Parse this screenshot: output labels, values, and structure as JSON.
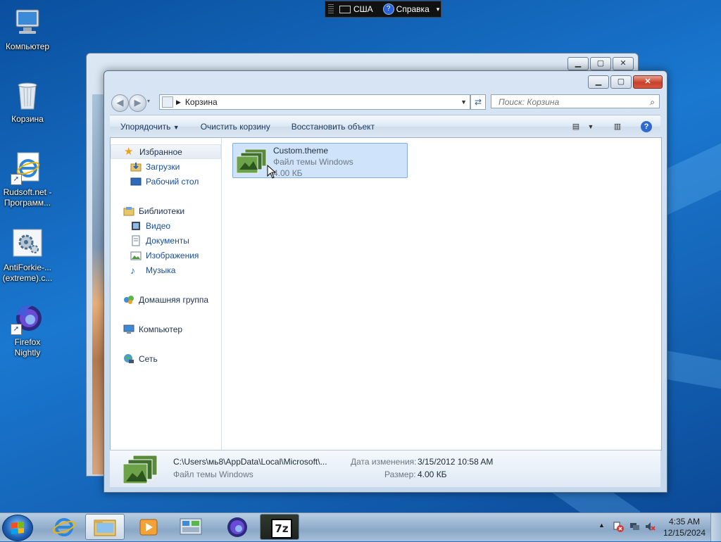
{
  "desktop": {
    "icons": [
      {
        "label": "Компьютер"
      },
      {
        "label": "Корзина"
      },
      {
        "label": "Rudsoft.net - Программ..."
      },
      {
        "label": "AntiForkie-... (extreme).c..."
      },
      {
        "label": "Firefox Nightly"
      }
    ]
  },
  "langbar": {
    "language": "США",
    "help": "Справка"
  },
  "window": {
    "address_path": "Корзина",
    "search_placeholder": "Поиск: Корзина",
    "toolbar": {
      "organize": "Упорядочить",
      "empty_bin": "Очистить корзину",
      "restore": "Восстановить объект"
    },
    "nav": {
      "favorites": "Избранное",
      "downloads": "Загрузки",
      "desktop": "Рабочий стол",
      "libraries": "Библиотеки",
      "video": "Видео",
      "documents": "Документы",
      "images": "Изображения",
      "music": "Музыка",
      "homegroup": "Домашняя группа",
      "computer": "Компьютер",
      "network": "Сеть"
    },
    "file": {
      "name": "Custom.theme",
      "type": "Файл темы Windows",
      "size": "4.00 КБ"
    },
    "details": {
      "path": "C:\\Users\\мь8\\AppData\\Local\\Microsoft\\...",
      "type": "Файл темы Windows",
      "modified_label": "Дата изменения:",
      "modified_value": "3/15/2012 10:58 AM",
      "size_label": "Размер:",
      "size_value": "4.00 КБ"
    }
  },
  "taskbar": {
    "time": "4:35 AM",
    "date": "12/15/2024"
  },
  "colors": {
    "accent": "#1a78d0",
    "selection": "#cfe4fa",
    "close_button": "#c7402a"
  }
}
